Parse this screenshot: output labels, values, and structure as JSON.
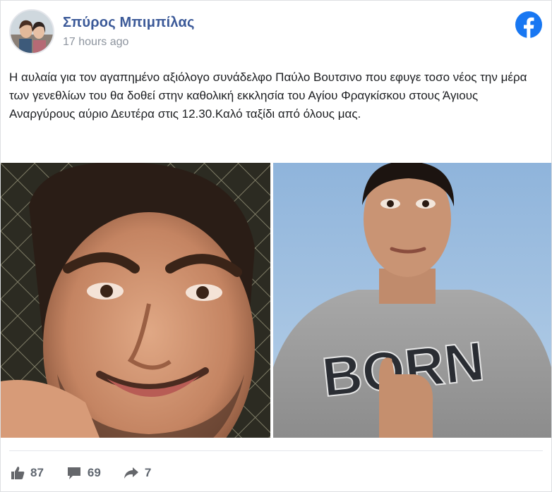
{
  "post": {
    "author": "Σπύρος Μπιμπίλας",
    "time": "17 hours ago",
    "text": "Η αυλαία για τον αγαπημένο αξιόλογο συνάδελφο Παύλο Βουτσινο που εφυγε τοσο νέος την μέρα των γενεθλίων του θα δοθεί στην καθολική εκκλησία του Αγίου Φραγκίσκου στους Άγιους Αναργύρους αύριο Δευτέρα στις 12.30.Καλό ταξίδι από όλους μας.",
    "shirt_print": "BORN"
  },
  "stats": {
    "likes": "87",
    "comments": "69",
    "shares": "7"
  },
  "icons": {
    "brand": "facebook-icon",
    "like": "thumbs-up-icon",
    "comment": "comment-icon",
    "share": "share-arrow-icon"
  },
  "colors": {
    "author_link": "#3b5998",
    "facebook_brand": "#1877f2",
    "muted_text": "#8d949e",
    "stats_text": "#606770"
  }
}
